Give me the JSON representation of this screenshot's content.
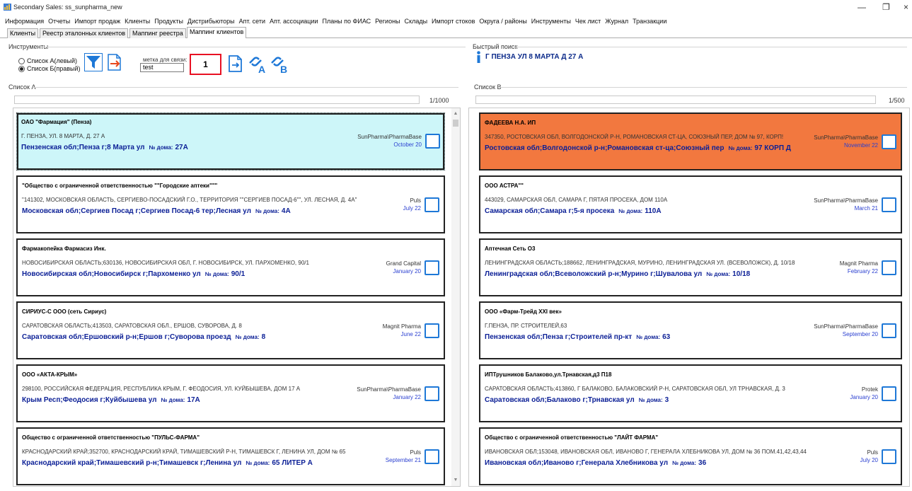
{
  "window": {
    "title": "Secondary Sales: ss_sunpharma_new",
    "minimize_glyph": "—",
    "restore_glyph": "❐",
    "close_glyph": "×"
  },
  "menu": [
    "Информация",
    "Отчеты",
    "Импорт продаж",
    "Клиенты",
    "Продукты",
    "Дистрибьюторы",
    "Апт. сети",
    "Апт. ассоциации",
    "Планы по ФИАС",
    "Регионы",
    "Склады",
    "Импорт стоков",
    "Округа / районы",
    "Инструменты",
    "Чек лист",
    "Журнал",
    "Транзакции"
  ],
  "tabs": [
    "Клиенты",
    "Реестр эталонных клиентов",
    "Маппинг реестра",
    "Маппинг клиентов"
  ],
  "tools": {
    "group_label": "Инструменты",
    "radio_left": "Список А(левый)",
    "radio_right": "Список Б(правый)",
    "tag_label": "метка для связи:",
    "tag_value": "test",
    "number_value": "1",
    "link_a_letter": "A",
    "link_b_letter": "B"
  },
  "quick_search": {
    "label": "Быстрый поиск",
    "value": "Г ПЕНЗА УЛ 8 МАРТА Д 27 А"
  },
  "list_a": {
    "label": "Список А",
    "counter": "1/1000",
    "cards": [
      {
        "name": "ОАО \"Фармация\" (Пенза)",
        "address": "Г. ПЕНЗА, УЛ. 8 МАРТА, Д. 27 А",
        "geo": "Пензенская обл;Пенза г;8 Марта ул",
        "house_label": "№ дома:",
        "house": "27А",
        "source": "SunPharma\\PharmaBase",
        "date": "October 20"
      },
      {
        "name": "\"Общество с ограниченной ответственностью \"\"Городские аптеки\"\"\"",
        "address": "\"141302, МОСКОВСКАЯ ОБЛАСТЬ, СЕРГИЕВО-ПОСАДСКИЙ Г.О., ТЕРРИТОРИЯ \"\"СЕРГИЕВ ПОСАД-6\"\", УЛ. ЛЕСНАЯ, Д. 4А\"",
        "geo": "Московская обл;Сергиев Посад г;Сергиев Посад-6 тер;Лесная ул",
        "house_label": "№ дома:",
        "house": "4А",
        "source": "Puls",
        "date": "July 22"
      },
      {
        "name": "Фармакопейка Фармасиз Инк.",
        "address": "НОВОСИБИРСКАЯ ОБЛАСТЬ;630136, НОВОСИБИРСКАЯ ОБЛ, Г. НОВОСИБИРСК, УЛ. ПАРХОМЕНКО, 90/1",
        "geo": "Новосибирская обл;Новосибирск г;Пархоменко ул",
        "house_label": "№ дома:",
        "house": "90/1",
        "source": "Grand Capital",
        "date": "January 20"
      },
      {
        "name": "СИРИУС-С ООО (сеть Сириус)",
        "address": "САРАТОВСКАЯ ОБЛАСТЬ;413503, САРАТОВСКАЯ ОБЛ., ЕРШОВ, СУВОРОВА, Д. 8",
        "geo": "Саратовская обл;Ершовский р-н;Ершов г;Суворова проезд",
        "house_label": "№ дома:",
        "house": "8",
        "source": "Magnit Pharma",
        "date": "June 22"
      },
      {
        "name": "ООО «АКТА-КРЫМ»",
        "address": "298100, РОССИЙСКАЯ ФЕДЕРАЦИЯ, РЕСПУБЛИКА КРЫМ, Г. ФЕОДОСИЯ, УЛ. КУЙБЫШЕВА, ДОМ 17 А",
        "geo": "Крым Респ;Феодосия г;Куйбышева ул",
        "house_label": "№ дома:",
        "house": "17А",
        "source": "SunPharma\\PharmaBase",
        "date": "January 22"
      },
      {
        "name": "Общество с ограниченной ответственностью \"ПУЛЬС-ФАРМА\"",
        "address": "КРАСНОДАРСКИЙ КРАЙ;352700, КРАСНОДАРСКИЙ КРАЙ, ТИМАШЕВСКИЙ Р-Н, ТИМАШЕВСК Г, ЛЕНИНА УЛ, ДОМ № 65",
        "geo": "Краснодарский край;Тимашевский р-н;Тимашевск г;Ленина ул",
        "house_label": "№ дома:",
        "house": "65 ЛИТЕР А",
        "source": "Puls",
        "date": "September 21"
      }
    ]
  },
  "list_b": {
    "label": "Список В",
    "counter": "1/500",
    "cards": [
      {
        "name": "ФАДЕЕВА Н.А. ИП",
        "address": "347350, РОСТОВСКАЯ ОБЛ, ВОЛГОДОНСКОЙ Р-Н, РОМАНОВСКАЯ СТ-ЦА, СОЮЗНЫЙ ПЕР, ДОМ № 97, КОРП!",
        "geo": "Ростовская обл;Волгодонской р-н;Романовская ст-ца;Союзный пер",
        "house_label": "№ дома:",
        "house": "97 КОРП Д",
        "source": "SunPharma\\PharmaBase",
        "date": "November 22"
      },
      {
        "name": "ООО АСТРА\"\"",
        "address": "443029, САМАРСКАЯ ОБЛ, САМАРА Г, ПЯТАЯ ПРОСЕКА, ДОМ 110А",
        "geo": "Самарская обл;Самара г;5-я просека",
        "house_label": "№ дома:",
        "house": "110А",
        "source": "SunPharma\\PharmaBase",
        "date": "March 21"
      },
      {
        "name": "Аптечная Сеть О3",
        "address": "ЛЕНИНГРАДСКАЯ ОБЛАСТЬ;188662, ЛЕНИНГРАДСКАЯ, МУРИНО, ЛЕНИНГРАДСКАЯ УЛ. (ВСЕВОЛОЖСК), Д. 10/18",
        "geo": "Ленинградская обл;Всеволожский р-н;Мурино г;Шувалова ул",
        "house_label": "№ дома:",
        "house": "10/18",
        "source": "Magnit Pharma",
        "date": "February 22"
      },
      {
        "name": "ООО «Фарм-Трейд XXI  век»",
        "address": "Г.ПЕНЗА, ПР. СТРОИТЕЛЕЙ,63",
        "geo": "Пензенская обл;Пенза г;Строителей пр-кт",
        "house_label": "№ дома:",
        "house": "63",
        "source": "SunPharma\\PharmaBase",
        "date": "September 20"
      },
      {
        "name": "ИПТрушников Балаково,ул.Трнавская,д3 П18",
        "address": "САРАТОВСКАЯ ОБЛАСТЬ;413860, Г БАЛАКОВО, БАЛАКОВСКИЙ Р-Н, САРАТОВСКАЯ ОБЛ, УЛ ТРНАВСКАЯ, Д. 3",
        "geo": "Саратовская обл;Балаково г;Трнавская ул",
        "house_label": "№ дома:",
        "house": "3",
        "source": "Protek",
        "date": "January 20"
      },
      {
        "name": "Общество с ограниченной ответственностью \"ЛАЙТ ФАРМА\"",
        "address": "ИВАНОВСКАЯ ОБЛ;153048, ИВАНОВСКАЯ ОБЛ, ИВАНОВО Г, ГЕНЕРАЛА ХЛЕБНИКОВА УЛ, ДОМ № 36 ПОМ.41,42,43,44",
        "geo": "Ивановская обл;Иваново г;Генерала Хлебникова ул",
        "house_label": "№ дома:",
        "house": "36",
        "source": "Puls",
        "date": "July 20"
      }
    ]
  },
  "colors": {
    "selected_card": "#cdf6f9",
    "highlighted_card": "#f2783f",
    "geo_text": "#0b1f96",
    "date_text": "#2a3fd0",
    "checkbox": "#1e78d7",
    "tool_icon": "#1e78d7",
    "number_box_border": "#e81123"
  },
  "icons": {
    "app": "app-icon",
    "filter": "funnel-icon",
    "export": "document-arrow-icon",
    "new_doc": "document-add-icon",
    "link_a": "link-a-icon",
    "link_b": "link-b-icon",
    "search": "info-icon"
  }
}
